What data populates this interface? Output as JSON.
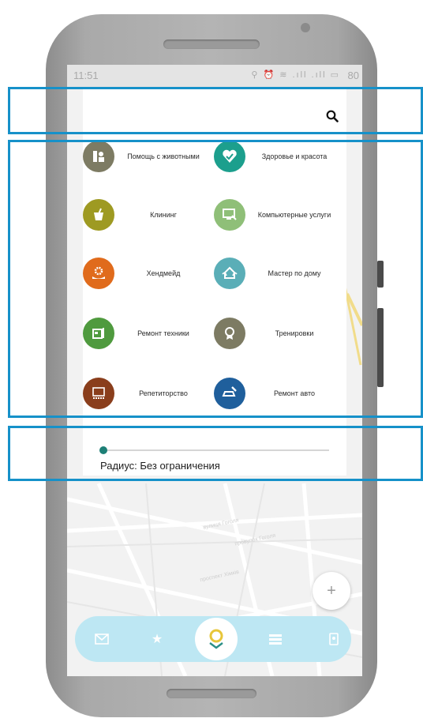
{
  "status": {
    "time": "11:51",
    "battery": "80"
  },
  "map": {
    "streets": [
      "вулиця Гоголя",
      "провулок Гоголя",
      "проспект Хімків"
    ]
  },
  "search": {
    "icon": "search-icon"
  },
  "categories": [
    {
      "label": "Помощь с животными",
      "icon": "pet-help-icon",
      "color": "#7d7b63"
    },
    {
      "label": "Здоровье и красота",
      "icon": "heart-health-icon",
      "color": "#1c9f8d"
    },
    {
      "label": "Клининг",
      "icon": "cleaning-bucket-icon",
      "color": "#9e9a22"
    },
    {
      "label": "Компьютерные услуги",
      "icon": "computer-service-icon",
      "color": "#8fbf78"
    },
    {
      "label": "Хендмейд",
      "icon": "handmade-gear-icon",
      "color": "#e06b1c"
    },
    {
      "label": "Мастер по дому",
      "icon": "home-master-icon",
      "color": "#5aaeb7"
    },
    {
      "label": "Ремонт техники",
      "icon": "tech-repair-icon",
      "color": "#4f9a3e"
    },
    {
      "label": "Тренировки",
      "icon": "training-medal-icon",
      "color": "#7d7b63"
    },
    {
      "label": "Репетиторство",
      "icon": "tutoring-board-icon",
      "color": "#8a3e1c"
    },
    {
      "label": "Ремонт авто",
      "icon": "car-repair-icon",
      "color": "#1f5f9c"
    }
  ],
  "radius": {
    "label": "Радиус: Без ограничения",
    "value_fraction": 0.0
  },
  "fab": {
    "label": "+"
  },
  "bottom_nav": {
    "items": [
      {
        "icon": "mail-icon"
      },
      {
        "icon": "star-icon"
      },
      {
        "icon": "location-pin-icon"
      },
      {
        "icon": "list-icon"
      },
      {
        "icon": "profile-card-icon"
      }
    ]
  },
  "colors": {
    "accent": "#1d7f76",
    "highlight_frame": "#1691c9",
    "nav_bg": "#bde7f3"
  }
}
